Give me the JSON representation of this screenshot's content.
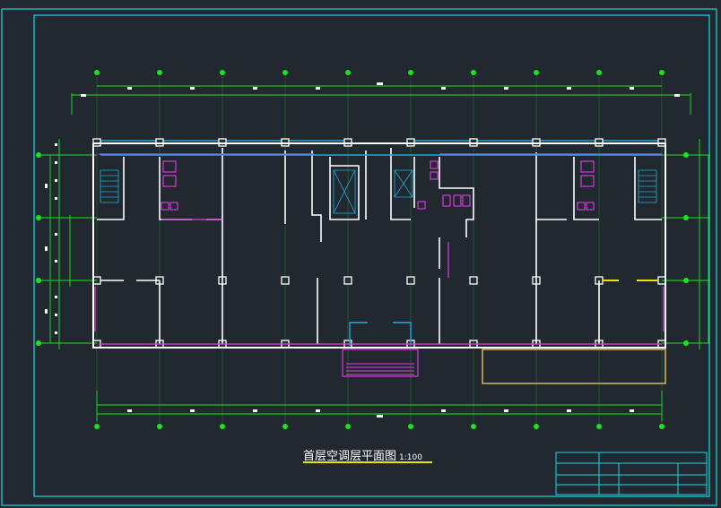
{
  "drawing": {
    "title": "首层空调层平面图",
    "scale": "1:100",
    "colors": {
      "background": "#212830",
      "frame": "#18d8e0",
      "dimension": "#19e619",
      "walls": "#ffffff",
      "hvac_pipe": "#e23ce8",
      "duct": "#1fa9d6",
      "accent_yellow": "#e6e600",
      "terrace": "#d9b266"
    }
  }
}
